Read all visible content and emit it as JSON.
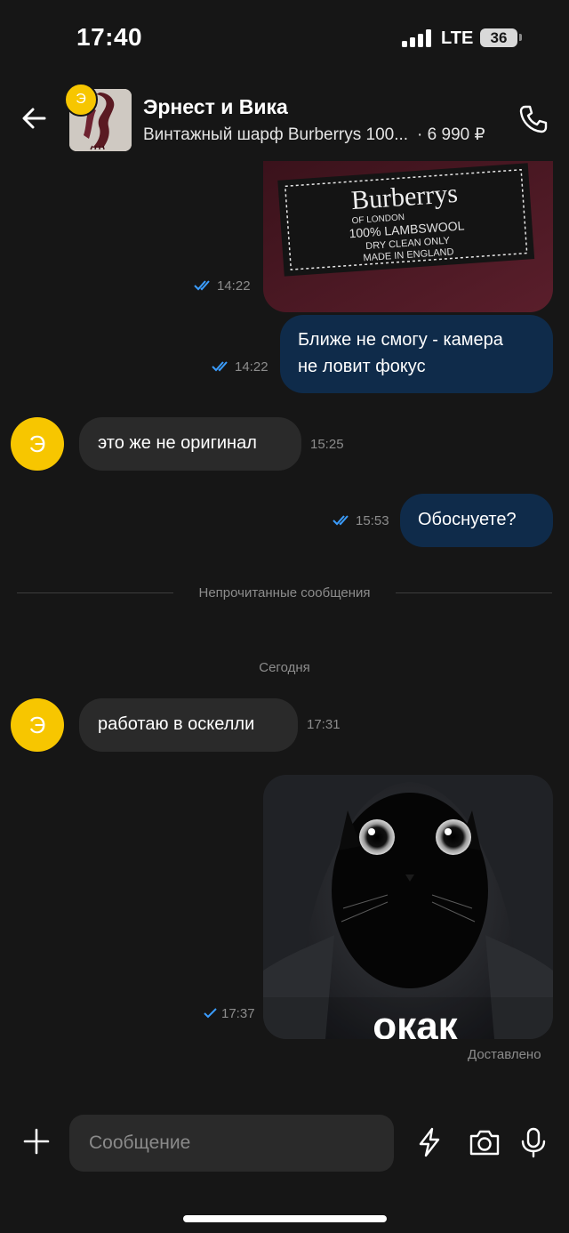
{
  "status_bar": {
    "time": "17:40",
    "network": "LTE",
    "battery": "36"
  },
  "header": {
    "chat_name": "Эрнест и Вика",
    "seller_initial": "Э",
    "product_title": "Винтажный шарф Burberrys 100...",
    "product_price": "· 6 990 ₽"
  },
  "messages": {
    "photo_label": {
      "time": "14:22",
      "label_lines": [
        "Burberrys",
        "OF LONDON",
        "100% LAMBSWOOL",
        "DRY CLEAN ONLY",
        "MADE IN ENGLAND"
      ]
    },
    "focus_text": {
      "text_line1": "Ближе не смогу - камера",
      "text_line2": "не ловит фокус",
      "time": "14:22"
    },
    "not_original": {
      "initial": "Э",
      "text": "это же не оригинал",
      "time": "15:25"
    },
    "justify": {
      "text": "Обоснуете?",
      "time": "15:53"
    },
    "unread_divider": "Непрочитанные сообщения",
    "date_divider": "Сегодня",
    "work_at": {
      "initial": "Э",
      "text": "работаю в оскелли",
      "time": "17:31"
    },
    "meme": {
      "caption": "окак",
      "time": "17:37",
      "status": "Доставлено"
    }
  },
  "input": {
    "placeholder": "Сообщение"
  },
  "colors": {
    "background": "#161616",
    "outgoing_bubble": "#0f2b4a",
    "incoming_bubble": "#2a2a2a",
    "avatar": "#f7c600",
    "read_check": "#3b9dff"
  },
  "icons": [
    "back-arrow-icon",
    "phone-icon",
    "double-check-icon",
    "single-check-icon",
    "plus-icon",
    "lightning-icon",
    "camera-icon",
    "microphone-icon"
  ]
}
